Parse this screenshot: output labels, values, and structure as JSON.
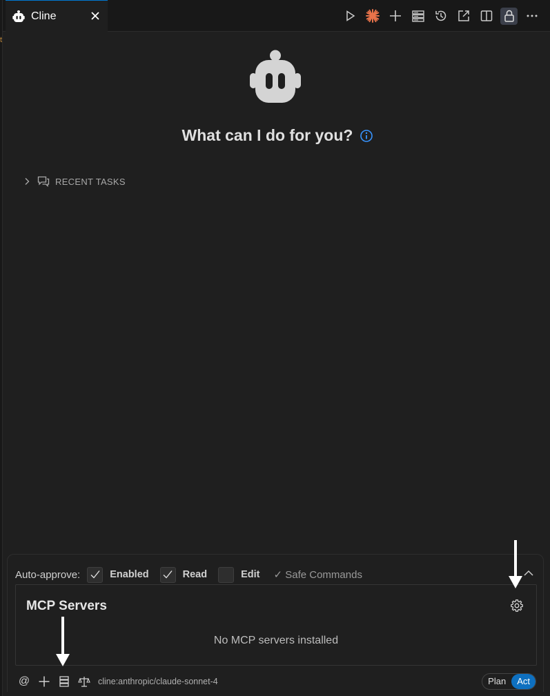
{
  "tab": {
    "title": "Cline",
    "close_icon": "close-icon"
  },
  "toolbar": {
    "icons": [
      "run-icon",
      "cline-sparkle-icon",
      "new-task-icon",
      "mcp-servers-icon",
      "history-icon",
      "open-in-editor-icon",
      "split-editor-icon",
      "lock-icon",
      "more-icon"
    ]
  },
  "main": {
    "headline": "What can I do for you?",
    "recent_tasks_label": "RECENT TASKS"
  },
  "auto_approve": {
    "label": "Auto-approve:",
    "options": [
      {
        "label": "Enabled",
        "checked": true
      },
      {
        "label": "Read",
        "checked": true
      },
      {
        "label": "Edit",
        "checked": false
      }
    ],
    "safe_commands": "✓ Safe Commands"
  },
  "mcp": {
    "title": "MCP Servers",
    "empty_text": "No MCP servers installed"
  },
  "footer": {
    "at_label": "@",
    "model": "cline:anthropic/claude-sonnet-4",
    "mode_plan": "Plan",
    "mode_act": "Act",
    "active_mode": "Act"
  },
  "colors": {
    "accent": "#0e70c0",
    "info": "#3794ff",
    "sparkle": "#e8734a",
    "background": "#1f1f1f"
  }
}
